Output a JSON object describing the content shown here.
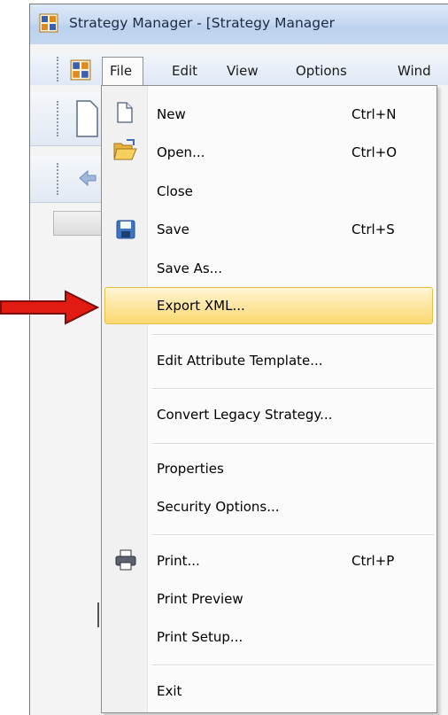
{
  "window": {
    "title": "Strategy Manager - [Strategy Manager"
  },
  "menubar": {
    "items": [
      "File",
      "Edit",
      "View",
      "Options",
      "Wind"
    ]
  },
  "file_menu": {
    "items": [
      {
        "label": "New",
        "shortcut": "Ctrl+N",
        "icon": "new-document-icon"
      },
      {
        "label": "Open...",
        "shortcut": "Ctrl+O",
        "icon": "open-folder-icon"
      },
      {
        "label": "Close",
        "shortcut": "",
        "icon": ""
      },
      {
        "label": "Save",
        "shortcut": "Ctrl+S",
        "icon": "save-disk-icon"
      },
      {
        "label": "Save As...",
        "shortcut": "",
        "icon": ""
      },
      {
        "label": "Export XML...",
        "shortcut": "",
        "icon": "",
        "highlighted": true
      },
      {
        "label": "Edit Attribute Template...",
        "shortcut": "",
        "icon": ""
      },
      {
        "label": "Convert Legacy Strategy...",
        "shortcut": "",
        "icon": ""
      },
      {
        "label": "Properties",
        "shortcut": "",
        "icon": ""
      },
      {
        "label": "Security Options...",
        "shortcut": "",
        "icon": ""
      },
      {
        "label": "Print...",
        "shortcut": "Ctrl+P",
        "icon": "printer-icon"
      },
      {
        "label": "Print Preview",
        "shortcut": "",
        "icon": ""
      },
      {
        "label": "Print Setup...",
        "shortcut": "",
        "icon": ""
      },
      {
        "label": "Exit",
        "shortcut": "",
        "icon": ""
      }
    ]
  },
  "annotation": {
    "pointer": "red-arrow-icon",
    "color": "#e21b12"
  },
  "colors": {
    "highlight": "#fde59d",
    "titlebar": "#c8daf1"
  }
}
